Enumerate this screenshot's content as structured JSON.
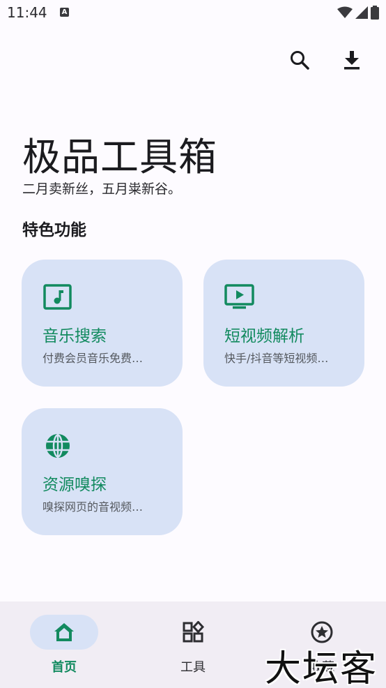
{
  "status_bar": {
    "time": "11:44",
    "notification_icon": "A"
  },
  "top_actions": {
    "search_icon": "search-icon",
    "download_icon": "download-icon"
  },
  "header": {
    "title": "极品工具箱",
    "subtitle": "二月卖新丝，五月粜新谷。"
  },
  "section": {
    "title": "特色功能"
  },
  "features": [
    {
      "title": "音乐搜索",
      "description": "付费会员音乐免费…",
      "icon": "music-icon"
    },
    {
      "title": "短视频解析",
      "description": "快手/抖音等短视频…",
      "icon": "video-icon"
    },
    {
      "title": "资源嗅探",
      "description": "嗅探网页的音视频…",
      "icon": "globe-icon"
    }
  ],
  "bottom_nav": {
    "items": [
      {
        "label": "首页",
        "icon": "home-icon",
        "active": true
      },
      {
        "label": "工具",
        "icon": "grid-icon",
        "active": false
      },
      {
        "label": "收藏",
        "icon": "star-icon",
        "active": false
      }
    ]
  },
  "watermark": "大坛客",
  "colors": {
    "accent": "#128a5f",
    "card_background": "#d8e2f6",
    "nav_background": "#f1edf4",
    "page_background": "#fdfbff"
  }
}
